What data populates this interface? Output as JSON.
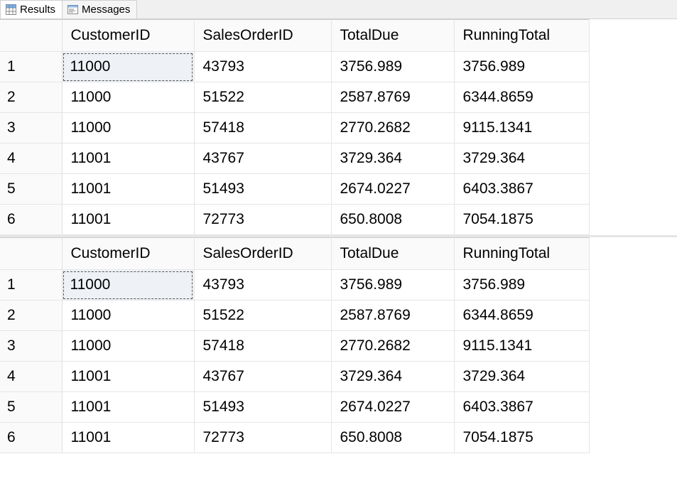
{
  "tabs": {
    "results_label": "Results",
    "messages_label": "Messages"
  },
  "grid1": {
    "columns": [
      "CustomerID",
      "SalesOrderID",
      "TotalDue",
      "RunningTotal"
    ],
    "rows": [
      {
        "n": "1",
        "CustomerID": "11000",
        "SalesOrderID": "43793",
        "TotalDue": "3756.989",
        "RunningTotal": "3756.989"
      },
      {
        "n": "2",
        "CustomerID": "11000",
        "SalesOrderID": "51522",
        "TotalDue": "2587.8769",
        "RunningTotal": "6344.8659"
      },
      {
        "n": "3",
        "CustomerID": "11000",
        "SalesOrderID": "57418",
        "TotalDue": "2770.2682",
        "RunningTotal": "9115.1341"
      },
      {
        "n": "4",
        "CustomerID": "11001",
        "SalesOrderID": "43767",
        "TotalDue": "3729.364",
        "RunningTotal": "3729.364"
      },
      {
        "n": "5",
        "CustomerID": "11001",
        "SalesOrderID": "51493",
        "TotalDue": "2674.0227",
        "RunningTotal": "6403.3867"
      },
      {
        "n": "6",
        "CustomerID": "11001",
        "SalesOrderID": "72773",
        "TotalDue": "650.8008",
        "RunningTotal": "7054.1875"
      }
    ]
  },
  "grid2": {
    "columns": [
      "CustomerID",
      "SalesOrderID",
      "TotalDue",
      "RunningTotal"
    ],
    "rows": [
      {
        "n": "1",
        "CustomerID": "11000",
        "SalesOrderID": "43793",
        "TotalDue": "3756.989",
        "RunningTotal": "3756.989"
      },
      {
        "n": "2",
        "CustomerID": "11000",
        "SalesOrderID": "51522",
        "TotalDue": "2587.8769",
        "RunningTotal": "6344.8659"
      },
      {
        "n": "3",
        "CustomerID": "11000",
        "SalesOrderID": "57418",
        "TotalDue": "2770.2682",
        "RunningTotal": "9115.1341"
      },
      {
        "n": "4",
        "CustomerID": "11001",
        "SalesOrderID": "43767",
        "TotalDue": "3729.364",
        "RunningTotal": "3729.364"
      },
      {
        "n": "5",
        "CustomerID": "11001",
        "SalesOrderID": "51493",
        "TotalDue": "2674.0227",
        "RunningTotal": "6403.3867"
      },
      {
        "n": "6",
        "CustomerID": "11001",
        "SalesOrderID": "72773",
        "TotalDue": "650.8008",
        "RunningTotal": "7054.1875"
      }
    ]
  }
}
